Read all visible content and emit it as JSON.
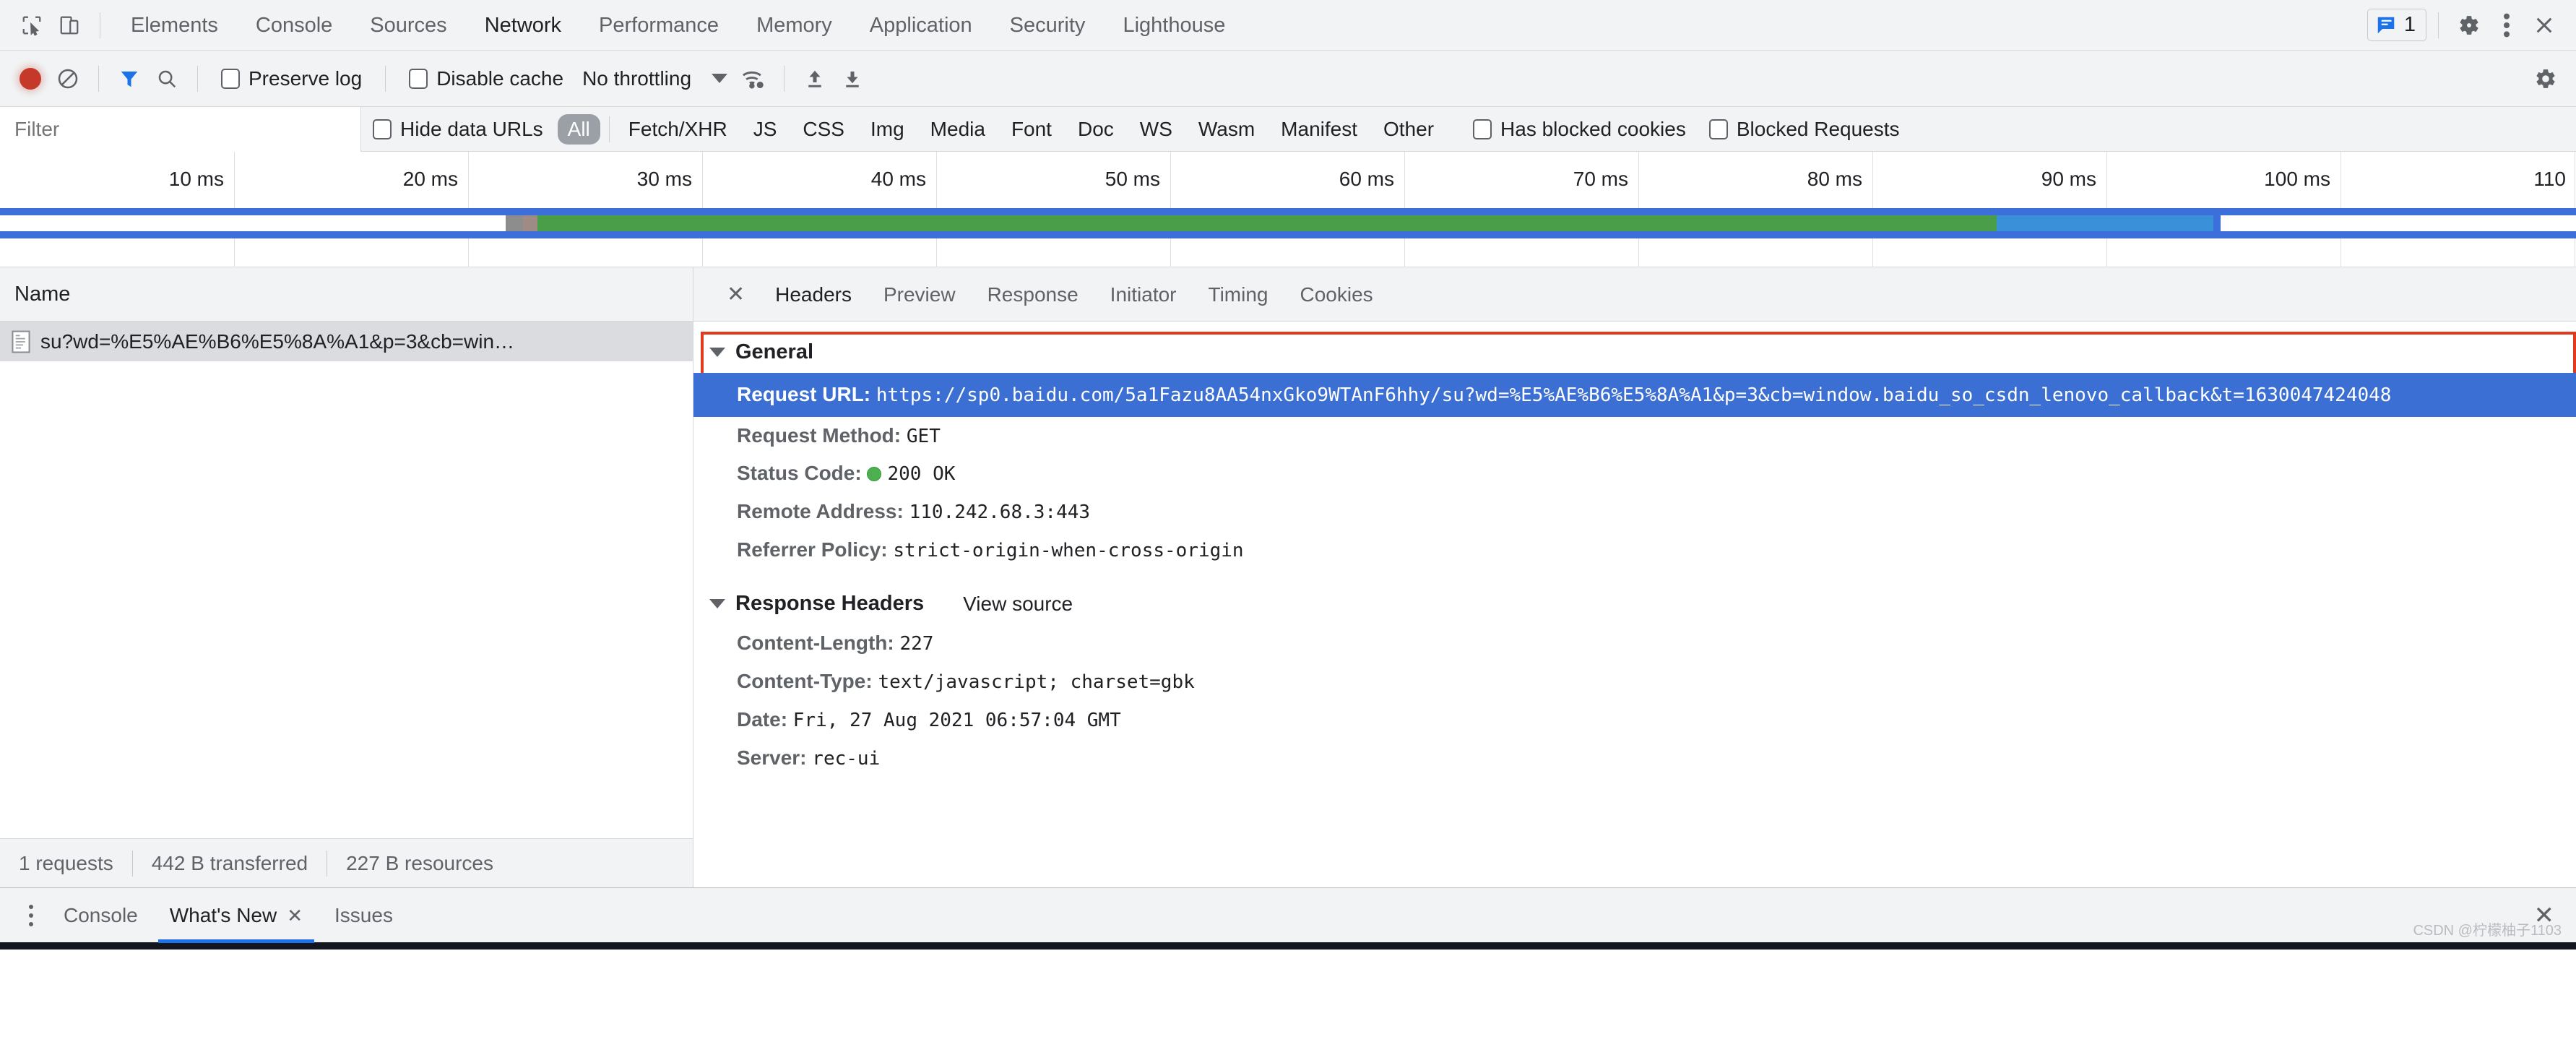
{
  "tabbar": {
    "icons": [
      "inspect-element-icon",
      "device-toolbar-icon"
    ],
    "tabs": [
      {
        "label": "Elements",
        "active": false
      },
      {
        "label": "Console",
        "active": false
      },
      {
        "label": "Sources",
        "active": false
      },
      {
        "label": "Network",
        "active": true
      },
      {
        "label": "Performance",
        "active": false
      },
      {
        "label": "Memory",
        "active": false
      },
      {
        "label": "Application",
        "active": false
      },
      {
        "label": "Security",
        "active": false
      },
      {
        "label": "Lighthouse",
        "active": false
      }
    ],
    "message_count": "1",
    "accent_blue": "#1a73e8"
  },
  "toolbar": {
    "record_title": "record-button",
    "clear_title": "clear-button",
    "filter_title": "filter-button",
    "search_title": "search-button",
    "preserve_log_label": "Preserve log",
    "preserve_log_checked": false,
    "disable_cache_label": "Disable cache",
    "disable_cache_checked": false,
    "throttling_value": "No throttling",
    "record_color": "#c5392a",
    "filter_active_color": "#1a73e8"
  },
  "filterbar": {
    "filter_placeholder": "Filter",
    "filter_value": "",
    "hide_data_urls_label": "Hide data URLs",
    "hide_data_urls_checked": false,
    "types": [
      {
        "label": "All",
        "selected": true
      },
      {
        "label": "Fetch/XHR",
        "selected": false
      },
      {
        "label": "JS",
        "selected": false
      },
      {
        "label": "CSS",
        "selected": false
      },
      {
        "label": "Img",
        "selected": false
      },
      {
        "label": "Media",
        "selected": false
      },
      {
        "label": "Font",
        "selected": false
      },
      {
        "label": "Doc",
        "selected": false
      },
      {
        "label": "WS",
        "selected": false
      },
      {
        "label": "Wasm",
        "selected": false
      },
      {
        "label": "Manifest",
        "selected": false
      },
      {
        "label": "Other",
        "selected": false
      }
    ],
    "has_blocked_cookies_label": "Has blocked cookies",
    "has_blocked_cookies_checked": false,
    "blocked_requests_label": "Blocked Requests",
    "blocked_requests_checked": false
  },
  "overview": {
    "ticks": [
      "10 ms",
      "20 ms",
      "30 ms",
      "40 ms",
      "50 ms",
      "60 ms",
      "70 ms",
      "80 ms",
      "90 ms",
      "100 ms",
      "110"
    ],
    "selection_color": "#3d6fdb",
    "waiting_color": "#4a9e4a",
    "download_color": "#3a91d9",
    "stalled_color": "#8d8d8d"
  },
  "requests_panel": {
    "column_header": "Name",
    "rows": [
      {
        "name": "su?wd=%E5%AE%B6%E5%8A%A1&p=3&cb=win…",
        "icon": "document-icon",
        "selected": true
      }
    ]
  },
  "detail": {
    "tabs": [
      {
        "label": "Headers",
        "active": true
      },
      {
        "label": "Preview",
        "active": false
      },
      {
        "label": "Response",
        "active": false
      },
      {
        "label": "Initiator",
        "active": false
      },
      {
        "label": "Timing",
        "active": false
      },
      {
        "label": "Cookies",
        "active": false
      }
    ],
    "general": {
      "title": "General",
      "request_url_key": "Request URL:",
      "request_url_value": "https://sp0.baidu.com/5a1Fazu8AA54nxGko9WTAnF6hhy/su?wd=%E5%AE%B6%E5%8A%A1&p=3&cb=window.baidu_so_csdn_lenovo_callback&t=1630047424048",
      "rows": [
        {
          "key": "Request Method:",
          "value": "GET"
        },
        {
          "key": "Status Code:",
          "value": "200 OK",
          "dot": true
        },
        {
          "key": "Remote Address:",
          "value": "110.242.68.3:443"
        },
        {
          "key": "Referrer Policy:",
          "value": "strict-origin-when-cross-origin"
        }
      ],
      "highlight_bg": "#3b6fd4",
      "annotation_box_color": "#e03a1f"
    },
    "response_headers": {
      "title": "Response Headers",
      "view_source": "View source",
      "rows": [
        {
          "key": "Content-Length:",
          "value": "227"
        },
        {
          "key": "Content-Type:",
          "value": "text/javascript; charset=gbk"
        },
        {
          "key": "Date:",
          "value": "Fri, 27 Aug 2021 06:57:04 GMT"
        },
        {
          "key": "Server:",
          "value": "rec-ui"
        }
      ]
    }
  },
  "status_bar": {
    "requests": "1 requests",
    "transferred": "442 B transferred",
    "resources": "227 B resources"
  },
  "drawer": {
    "tabs": [
      {
        "label": "Console",
        "active": false,
        "closable": false
      },
      {
        "label": "What's New",
        "active": true,
        "closable": true
      },
      {
        "label": "Issues",
        "active": false,
        "closable": false
      }
    ],
    "close_glyph": "✕",
    "watermark": "CSDN @柠檬柚子1103"
  }
}
